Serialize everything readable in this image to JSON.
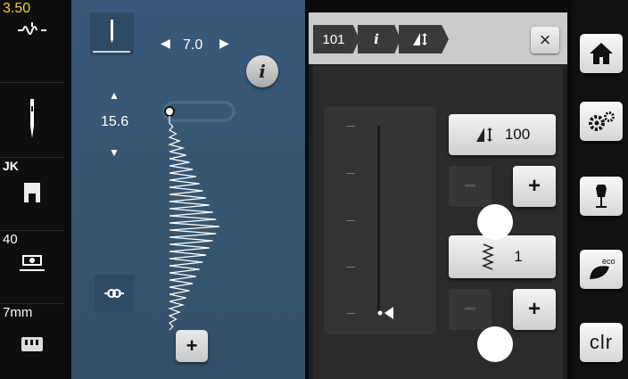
{
  "status": {
    "thread_tension": "3.50",
    "presser_foot_code": "JK",
    "needle_position": "40",
    "needle_size": "7mm"
  },
  "stitch": {
    "width_value": "7.0",
    "length_value": "15.6",
    "add_button_label": "+"
  },
  "panel": {
    "crumbs": [
      "101",
      "i",
      ""
    ],
    "close_label": "×",
    "balance_value": "100",
    "repeat_value": "1",
    "minus_label": "−",
    "plus_label": "+"
  },
  "nav": {
    "clr_label": "clr",
    "eco_label": "eco"
  },
  "icons": [
    "threading-icon",
    "needle-icon",
    "presser-foot-icon",
    "bobbin-icon",
    "feed-dog-icon",
    "info-icon",
    "tie-off-icon",
    "home-icon",
    "settings-icon",
    "dress-form-icon",
    "eco-leaf-icon",
    "balance-icon",
    "repeat-icon"
  ]
}
